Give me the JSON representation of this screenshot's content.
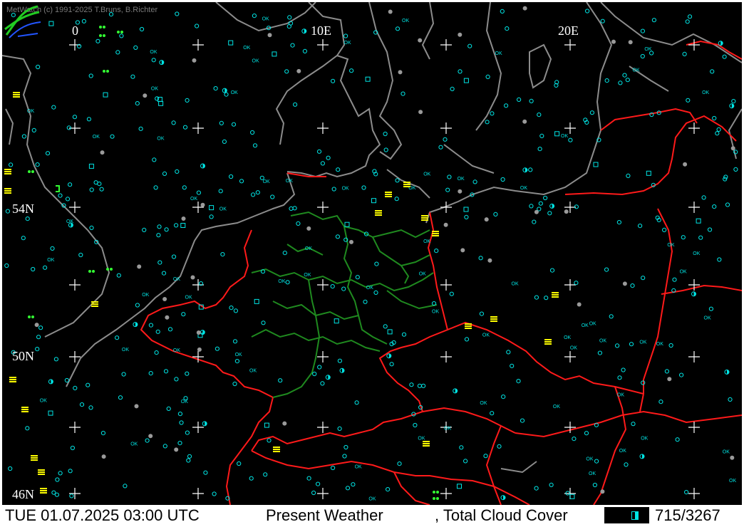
{
  "app": {
    "copyright": "MetWatch  (c) 1991-2025 T.Bruns, B.Richter"
  },
  "map": {
    "lon_labels": [
      "0",
      "10E",
      "20E"
    ],
    "lat_labels": [
      "54N",
      "50N",
      "46N"
    ],
    "ok_label": "OK",
    "colors": {
      "background": "#000000",
      "coastline": "#8c8c8c",
      "border": "#ff1a1a",
      "state_border": "#1f8a1f",
      "station": "#00e5e5",
      "rain": "#ff9900",
      "fog": "#ffff00",
      "drizzle": "#33ff33",
      "grid": "#ffffff",
      "label": "#ffffff"
    }
  },
  "status": {
    "datetime": "TUE 01.07.2025 03:00 UTC",
    "product": "Present Weather",
    "overlay": ", Total Cloud Cover",
    "count": "715/3267"
  }
}
